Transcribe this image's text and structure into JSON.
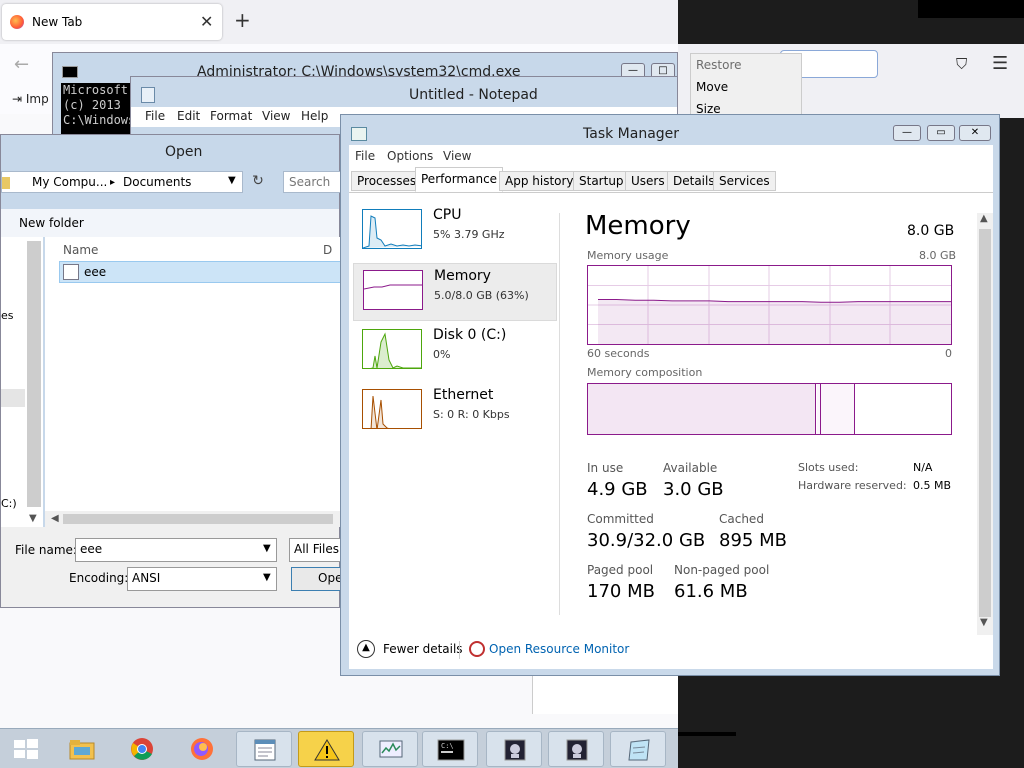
{
  "firefox": {
    "tab_title": "New Tab",
    "tab_close": "✕",
    "new_tab": "+",
    "back": "←",
    "bookmark_import": "Imp",
    "pocket_icon": "pocket-icon",
    "menu_icon": "☰"
  },
  "system_menu": {
    "items": [
      "Restore",
      "Move",
      "Size"
    ]
  },
  "cmd": {
    "title": "Administrator: C:\\Windows\\system32\\cmd.exe",
    "lines": [
      "Microsoft",
      "(c) 2013",
      "",
      "C:\\Windows"
    ]
  },
  "notepad": {
    "title": "Untitled - Notepad",
    "menu": [
      "File",
      "Edit",
      "Format",
      "View",
      "Help"
    ]
  },
  "open_dialog": {
    "title": "Open",
    "breadcrumb": [
      "My Compu...",
      "▸",
      "Documents"
    ],
    "search_placeholder": "Search",
    "new_folder": "New folder",
    "column_name": "Name",
    "column_d": "D",
    "nav_partial_1": "es",
    "nav_partial_2": "C:)",
    "file": "eee",
    "file_name_label": "File name:",
    "file_name_value": "eee",
    "filter": "All Files",
    "encoding_label": "Encoding:",
    "encoding_value": "ANSI",
    "open_button": "Ope"
  },
  "task_manager": {
    "title": "Task Manager",
    "menu": [
      "File",
      "Options",
      "View"
    ],
    "tabs": [
      "Processes",
      "Performance",
      "App history",
      "Startup",
      "Users",
      "Details",
      "Services"
    ],
    "active_tab": "Performance",
    "sidebar": [
      {
        "name": "CPU",
        "sub": "5% 3.79 GHz",
        "color": "#117dbb"
      },
      {
        "name": "Memory",
        "sub": "5.0/8.0 GB (63%)",
        "color": "#8b1a8b"
      },
      {
        "name": "Disk 0 (C:)",
        "sub": "0%",
        "color": "#4da60c"
      },
      {
        "name": "Ethernet",
        "sub": "S: 0 R: 0 Kbps",
        "color": "#a74f01"
      }
    ],
    "selected_resource": "Memory",
    "heading": "Memory",
    "total": "8.0 GB",
    "usage_label": "Memory usage",
    "usage_max": "8.0 GB",
    "time_span": "60 seconds",
    "time_end": "0",
    "composition_label": "Memory composition",
    "memory_usage_history_gb": [
      5.2,
      5.2,
      5.1,
      5.1,
      5.0,
      5.0,
      5.0,
      4.9,
      4.9,
      4.9,
      4.9,
      4.9,
      4.8,
      4.8,
      4.9,
      4.9,
      4.9,
      4.9,
      4.9,
      4.9
    ],
    "stats": {
      "in_use_label": "In use",
      "in_use": "4.9 GB",
      "available_label": "Available",
      "available": "3.0 GB",
      "committed_label": "Committed",
      "committed": "30.9/32.0 GB",
      "cached_label": "Cached",
      "cached": "895 MB",
      "paged_label": "Paged pool",
      "paged": "170 MB",
      "nonpaged_label": "Non-paged pool",
      "nonpaged": "61.6 MB",
      "slots_label": "Slots used:",
      "slots": "N/A",
      "hwres_label": "Hardware reserved:",
      "hwres": "0.5 MB"
    },
    "fewer_details": "Fewer details",
    "resource_monitor": "Open Resource Monitor"
  },
  "taskbar": {
    "items": [
      "start-icon",
      "file-explorer-icon",
      "chrome-icon",
      "firefox-icon",
      "notepad-icon",
      "warning-icon",
      "task-manager-icon",
      "cmd-icon",
      "tool-icon-1",
      "tool-icon-2",
      "notepad-edit-icon"
    ]
  },
  "colors": {
    "memory_accent": "#8b1a8b",
    "cpu_accent": "#117dbb",
    "disk_accent": "#4da60c",
    "ethernet_accent": "#a74f01",
    "link": "#0063b1"
  }
}
